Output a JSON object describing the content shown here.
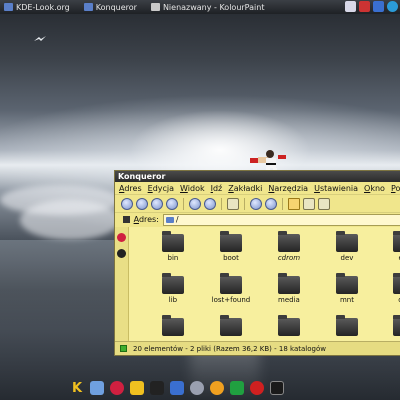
{
  "top_panel": {
    "tasks": [
      {
        "label": "KDE-Look.org",
        "icon": "browser-icon",
        "color": "#5a7fc9"
      },
      {
        "label": "Konqueror",
        "icon": "folder-icon",
        "color": "#5a7fc9"
      },
      {
        "label": "Nienazwany - KolourPaint",
        "icon": "paint-icon",
        "color": "#c9c9c9"
      }
    ],
    "tray_icons": [
      "mail-icon",
      "network-icon",
      "update-icon",
      "globe-icon"
    ]
  },
  "window": {
    "title": "Konqueror",
    "menu": [
      "Adres",
      "Edycja",
      "Widok",
      "Idź",
      "Zakładki",
      "Narzędzia",
      "Ustawienia",
      "Okno",
      "Pomoc"
    ],
    "toolbar_icons": [
      "up-icon",
      "back-icon",
      "forward-icon",
      "home-icon",
      "reload-icon",
      "stop-icon",
      "print-icon",
      "zoom-in-icon",
      "zoom-out-icon",
      "icon-view-icon",
      "detail-view-icon",
      "preview-icon"
    ],
    "address_label": "Adres:",
    "address_value": "/",
    "files": [
      {
        "name": "bin"
      },
      {
        "name": "boot"
      },
      {
        "name": "cdrom"
      },
      {
        "name": "dev"
      },
      {
        "name": "etc"
      },
      {
        "name": "lib"
      },
      {
        "name": "lost+found"
      },
      {
        "name": "media"
      },
      {
        "name": "mnt"
      },
      {
        "name": "opt"
      },
      {
        "name": ""
      },
      {
        "name": ""
      },
      {
        "name": ""
      },
      {
        "name": ""
      },
      {
        "name": ""
      }
    ],
    "status": "20 elementów - 2 pliki (Razem 36,2 KB) - 18 katalogów"
  },
  "dock_icons": [
    "kde-menu-icon",
    "broom-icon",
    "debian-icon",
    "tux-icon",
    "penguin-icon",
    "network-icon",
    "eye-icon",
    "sun-icon",
    "game-icon",
    "stop-icon",
    "terminal-icon"
  ],
  "colors": {
    "window_bg": "#f0e68c",
    "folder": "#3a3a3a",
    "accent": "#5a7fc9"
  }
}
